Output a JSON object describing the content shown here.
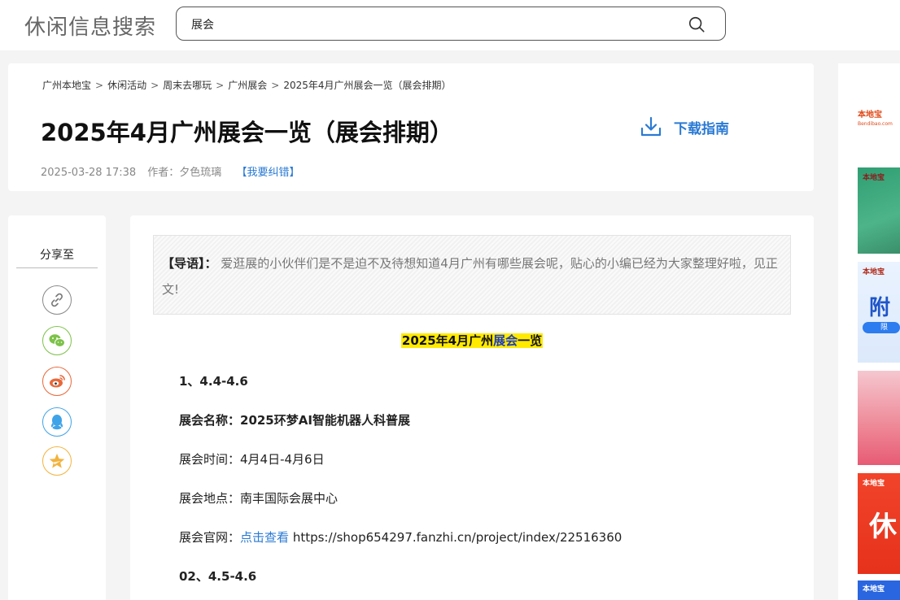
{
  "header": {
    "site_title": "休闲信息搜索",
    "search_value": "展会"
  },
  "breadcrumb": [
    "广州本地宝",
    "休闲活动",
    "周末去哪玩",
    "广州展会",
    "2025年4月广州展会一览（展会排期）"
  ],
  "breadcrumb_separators": [
    ">",
    ">",
    ">",
    ">"
  ],
  "article": {
    "title": "2025年4月广州展会一览（展会排期）",
    "download_label": "下载指南",
    "date": "2025-03-28 17:38",
    "author": "作者：夕色琉璃",
    "report_link": "【我要纠错】"
  },
  "share": {
    "title": "分享至",
    "buttons": [
      "link-icon",
      "wechat-icon",
      "weibo-icon",
      "qq-icon",
      "qzone-icon"
    ]
  },
  "content": {
    "intro_lead": "【导语】：",
    "intro_text": "爱逛展的小伙伴们是不是迫不及待想知道4月广州有哪些展会呢，贴心的小编已经为大家整理好啦，见正文!",
    "section_heading_a": "2025年4月广州",
    "section_heading_link": "展会",
    "section_heading_b": "一览",
    "item1_number": "1、4.4-4.6",
    "item1_name": "展会名称：2025环梦AI智能机器人科普展",
    "item1_time": "展会时间：4月4日-4月6日",
    "item1_place": "展会地点：南丰国际会展中心",
    "item1_site_label": "展会官网：",
    "item1_site_link": "点击查看",
    "item1_site_url": "https://shop654297.fanzhi.cn/project/index/22516360",
    "item2_number": "02、4.5-4.6"
  },
  "ads": {
    "logo_text": "本地宝",
    "logo_sub": "Bendibao.com",
    "ad_big_1": "附",
    "ad_big_2": "休",
    "ad_small_1": "限"
  },
  "colors": {
    "accent_blue": "#2a7ad4",
    "highlight_yellow": "#ffea00"
  }
}
